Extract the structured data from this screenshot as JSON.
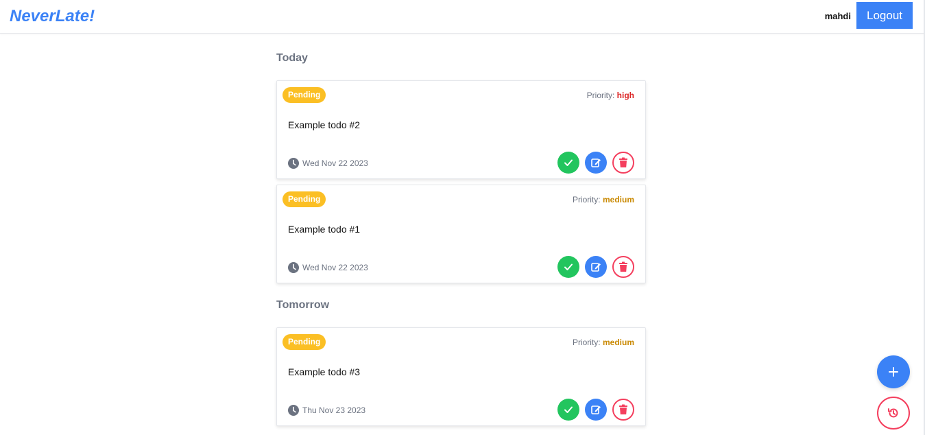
{
  "header": {
    "brand": "NeverLate!",
    "username": "mahdi",
    "logout_label": "Logout"
  },
  "sections": [
    {
      "title": "Today"
    },
    {
      "title": "Tomorrow"
    }
  ],
  "todos": [
    {
      "status": "Pending",
      "priority_label": "Priority:",
      "priority": "high",
      "text": "Example todo #2",
      "date": "Wed Nov 22 2023"
    },
    {
      "status": "Pending",
      "priority_label": "Priority:",
      "priority": "medium",
      "text": "Example todo #1",
      "date": "Wed Nov 22 2023"
    },
    {
      "status": "Pending",
      "priority_label": "Priority:",
      "priority": "medium",
      "text": "Example todo #3",
      "date": "Thu Nov 23 2023"
    }
  ],
  "icons": {
    "clock": "clock-icon",
    "done": "check-icon",
    "edit": "edit-icon",
    "delete": "trash-icon",
    "add": "plus-icon",
    "history": "history-icon"
  },
  "colors": {
    "accent": "#3b82f6",
    "pending": "#fbbf24",
    "high": "#dc2626",
    "medium": "#ca8a04",
    "done": "#22c55e",
    "delete": "#f43f5e"
  }
}
